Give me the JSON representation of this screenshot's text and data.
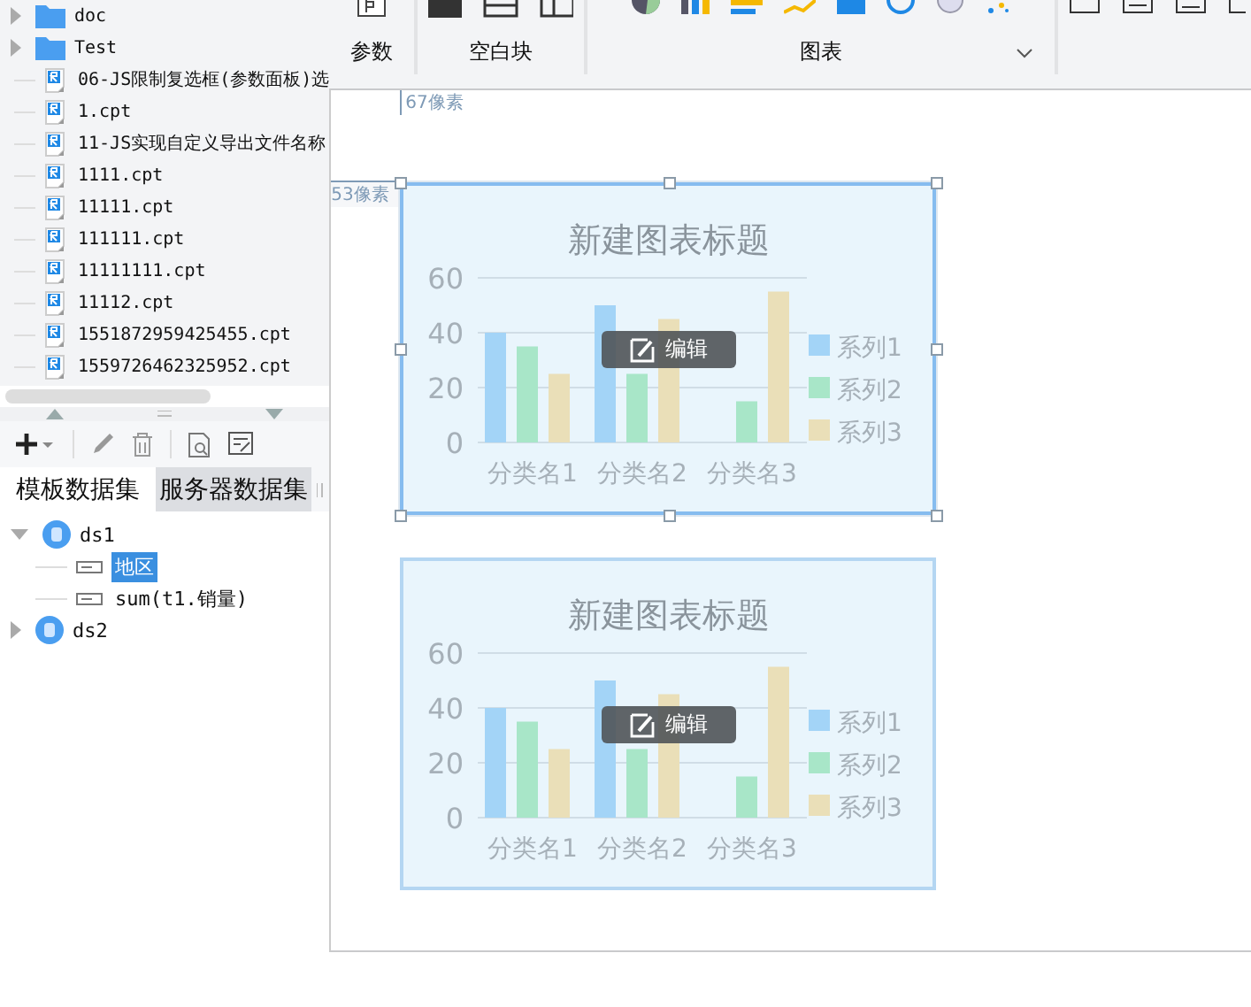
{
  "file_tree": [
    {
      "kind": "folder",
      "label": "doc",
      "expanded": false
    },
    {
      "kind": "folder",
      "label": "Test",
      "expanded": false
    },
    {
      "kind": "file",
      "label": "06-JS限制复选框(参数面板)选"
    },
    {
      "kind": "file",
      "label": "1.cpt"
    },
    {
      "kind": "file",
      "label": "11-JS实现自定义导出文件名称"
    },
    {
      "kind": "file",
      "label": "1111.cpt"
    },
    {
      "kind": "file",
      "label": "11111.cpt"
    },
    {
      "kind": "file",
      "label": "111111.cpt"
    },
    {
      "kind": "file",
      "label": "11111111.cpt"
    },
    {
      "kind": "file",
      "label": "11112.cpt"
    },
    {
      "kind": "file",
      "label": "1551872959425455.cpt"
    },
    {
      "kind": "file",
      "label": "1559726462325952.cpt"
    }
  ],
  "dataset_tabs": [
    {
      "label": "模板数据集",
      "selected": true
    },
    {
      "label": "服务器数据集",
      "selected": false
    }
  ],
  "datasets": [
    {
      "label": "ds1",
      "expanded": true,
      "children": [
        {
          "label": "地区",
          "selected": true
        },
        {
          "label": "sum(t1.销量)",
          "selected": false
        }
      ]
    },
    {
      "label": "ds2",
      "expanded": false
    }
  ],
  "ribbon": {
    "groups": [
      {
        "label": "参数",
        "icons": [
          {
            "kind": "param"
          }
        ]
      },
      {
        "label": "空白块",
        "icons": [
          {
            "kind": "solid"
          },
          {
            "kind": "split-h"
          },
          {
            "kind": "split-v"
          }
        ]
      },
      {
        "label": "图表",
        "icons": [
          {
            "kind": "pie"
          },
          {
            "kind": "bar"
          },
          {
            "kind": "hbar"
          },
          {
            "kind": "line"
          },
          {
            "kind": "area"
          },
          {
            "kind": "gauge"
          },
          {
            "kind": "radar"
          },
          {
            "kind": "scatter"
          }
        ],
        "more": true
      }
    ]
  },
  "rulers": {
    "top": "67像素",
    "left": "53像素"
  },
  "charts": [
    {
      "selected": true,
      "edit_label": "编辑",
      "chart_data": {
        "type": "bar",
        "title": "新建图表标题",
        "legend": true,
        "categories": [
          "分类名1",
          "分类名2",
          "分类名3"
        ],
        "series": [
          {
            "name": "系列1",
            "color": "#a3d4f7",
            "values": [
              40,
              50,
              null
            ]
          },
          {
            "name": "系列2",
            "color": "#a8e6c8",
            "values": [
              35,
              25,
              15
            ]
          },
          {
            "name": "系列3",
            "color": "#eadfb8",
            "values": [
              25,
              45,
              55
            ]
          }
        ],
        "ylim": [
          0,
          60
        ],
        "yticks": [
          0,
          20,
          40,
          60
        ]
      }
    },
    {
      "selected": false,
      "edit_label": "编辑",
      "chart_data": {
        "type": "bar",
        "title": "新建图表标题",
        "legend": true,
        "categories": [
          "分类名1",
          "分类名2",
          "分类名3"
        ],
        "series": [
          {
            "name": "系列1",
            "color": "#a3d4f7",
            "values": [
              40,
              50,
              null
            ]
          },
          {
            "name": "系列2",
            "color": "#a8e6c8",
            "values": [
              35,
              25,
              15
            ]
          },
          {
            "name": "系列3",
            "color": "#eadfb8",
            "values": [
              25,
              45,
              55
            ]
          }
        ],
        "ylim": [
          0,
          60
        ],
        "yticks": [
          0,
          20,
          40,
          60
        ]
      }
    }
  ]
}
